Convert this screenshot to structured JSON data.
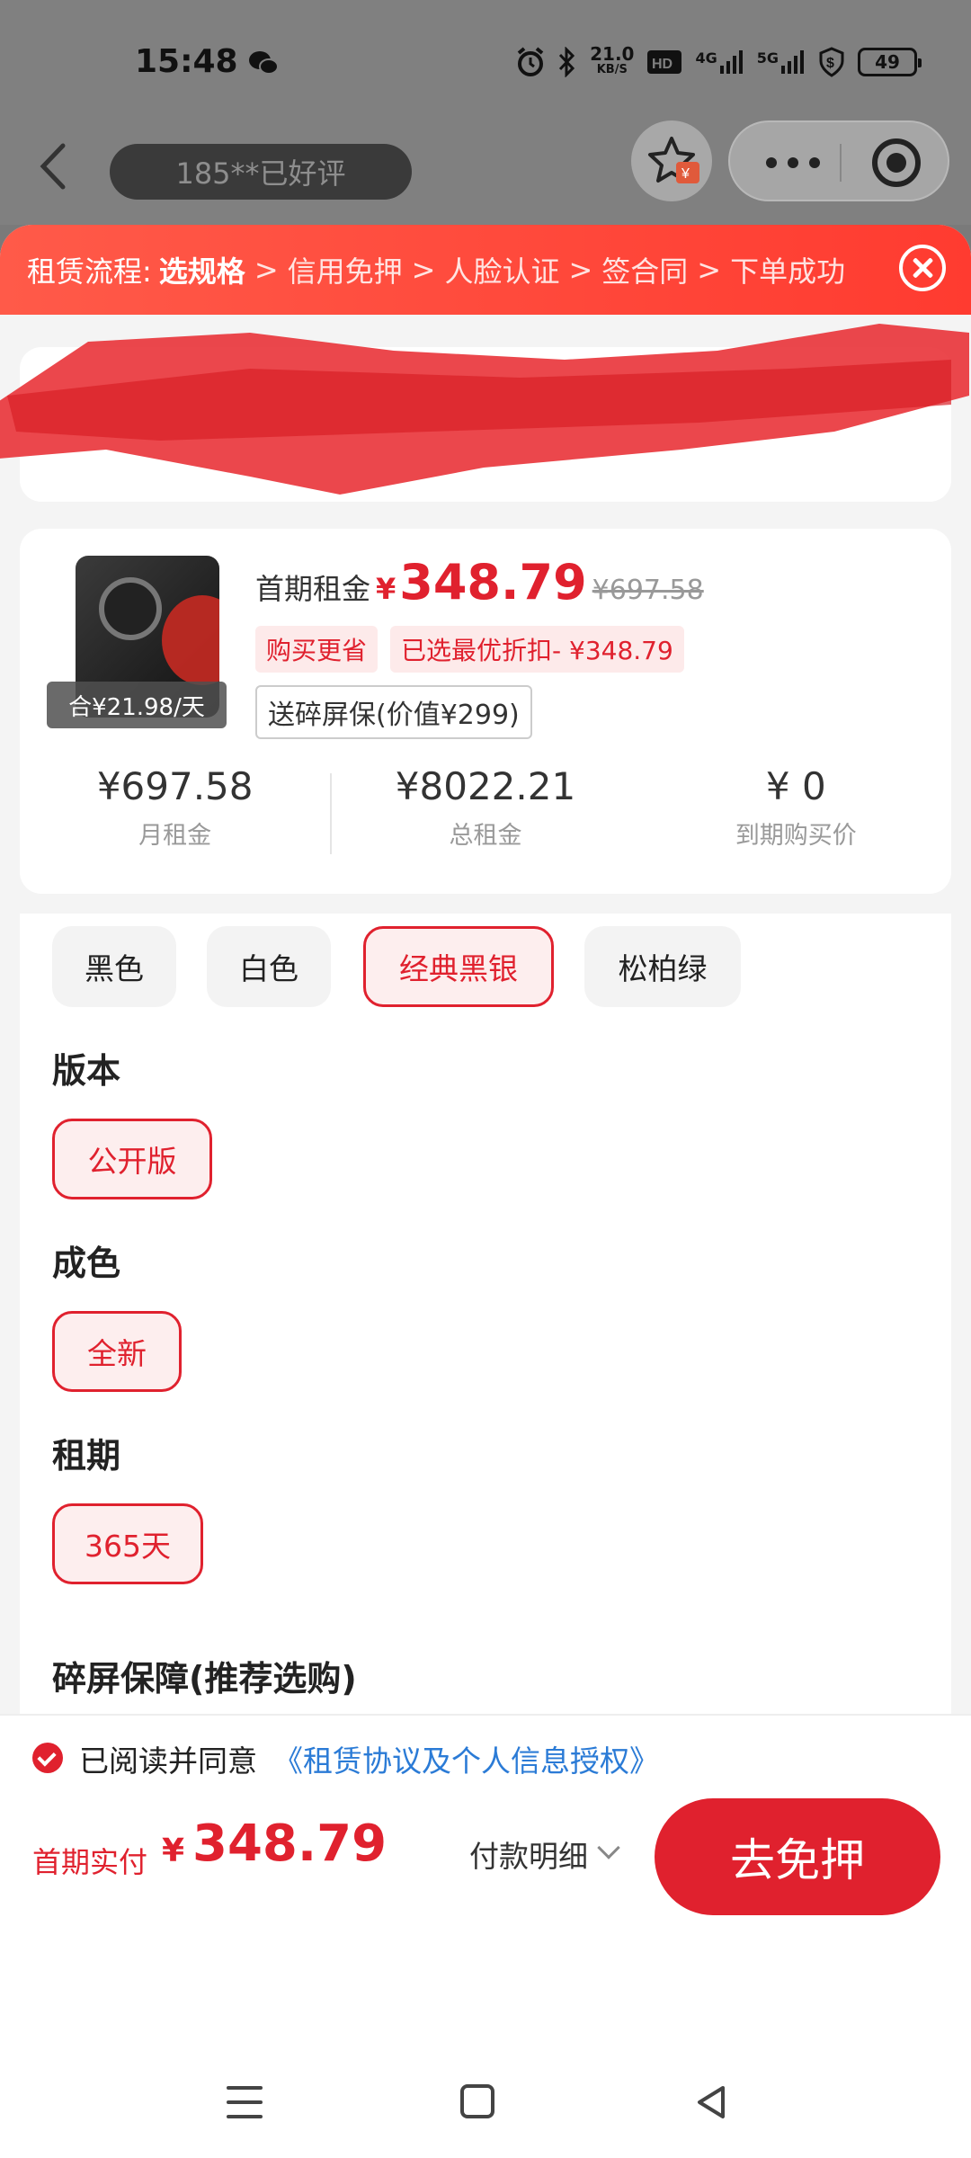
{
  "status_bar": {
    "time": "15:48",
    "net_speed_top": "21.0",
    "net_speed_unit": "KB/S",
    "signal_1": "4G",
    "signal_2": "5G",
    "battery": "49"
  },
  "top_nav": {
    "review_pill": "185**已好评"
  },
  "process": {
    "title": "租赁流程:",
    "current_step": "选规格",
    "steps": [
      "信用免押",
      "人脸认证",
      "签合同",
      "下单成功"
    ],
    "separator": ">"
  },
  "product": {
    "daily_price": "合¥21.98/天",
    "first_label": "首期租金",
    "currency": "¥",
    "first_price": "348.79",
    "original_price": "¥697.58",
    "tag_buy": "购买更省",
    "tag_discount": "已选最优折扣- ¥348.79",
    "gift": "送碎屏保(价值¥299)"
  },
  "stats": [
    {
      "value": "¥697.58",
      "label": "月租金"
    },
    {
      "value": "¥8022.21",
      "label": "总租金"
    },
    {
      "value": "¥ 0",
      "label": "到期购买价"
    }
  ],
  "colors": {
    "options": [
      "黑色",
      "白色",
      "经典黑银",
      "松柏绿"
    ],
    "selected": "经典黑银"
  },
  "version": {
    "title": "版本",
    "option": "公开版"
  },
  "condition": {
    "title": "成色",
    "option": "全新"
  },
  "term": {
    "title": "租期",
    "option": "365天"
  },
  "protection": {
    "title": "碎屏保障(推荐选购)"
  },
  "footer": {
    "agree_text": "已阅读并同意",
    "agree_link": "《租赁协议及个人信息授权》",
    "pay_label": "首期实付",
    "pay_currency": "¥",
    "pay_amount": "348.79",
    "pay_detail": "付款明细",
    "cta": "去免押"
  },
  "theme": {
    "accent": "#e0212e",
    "link": "#2b7bd6"
  }
}
